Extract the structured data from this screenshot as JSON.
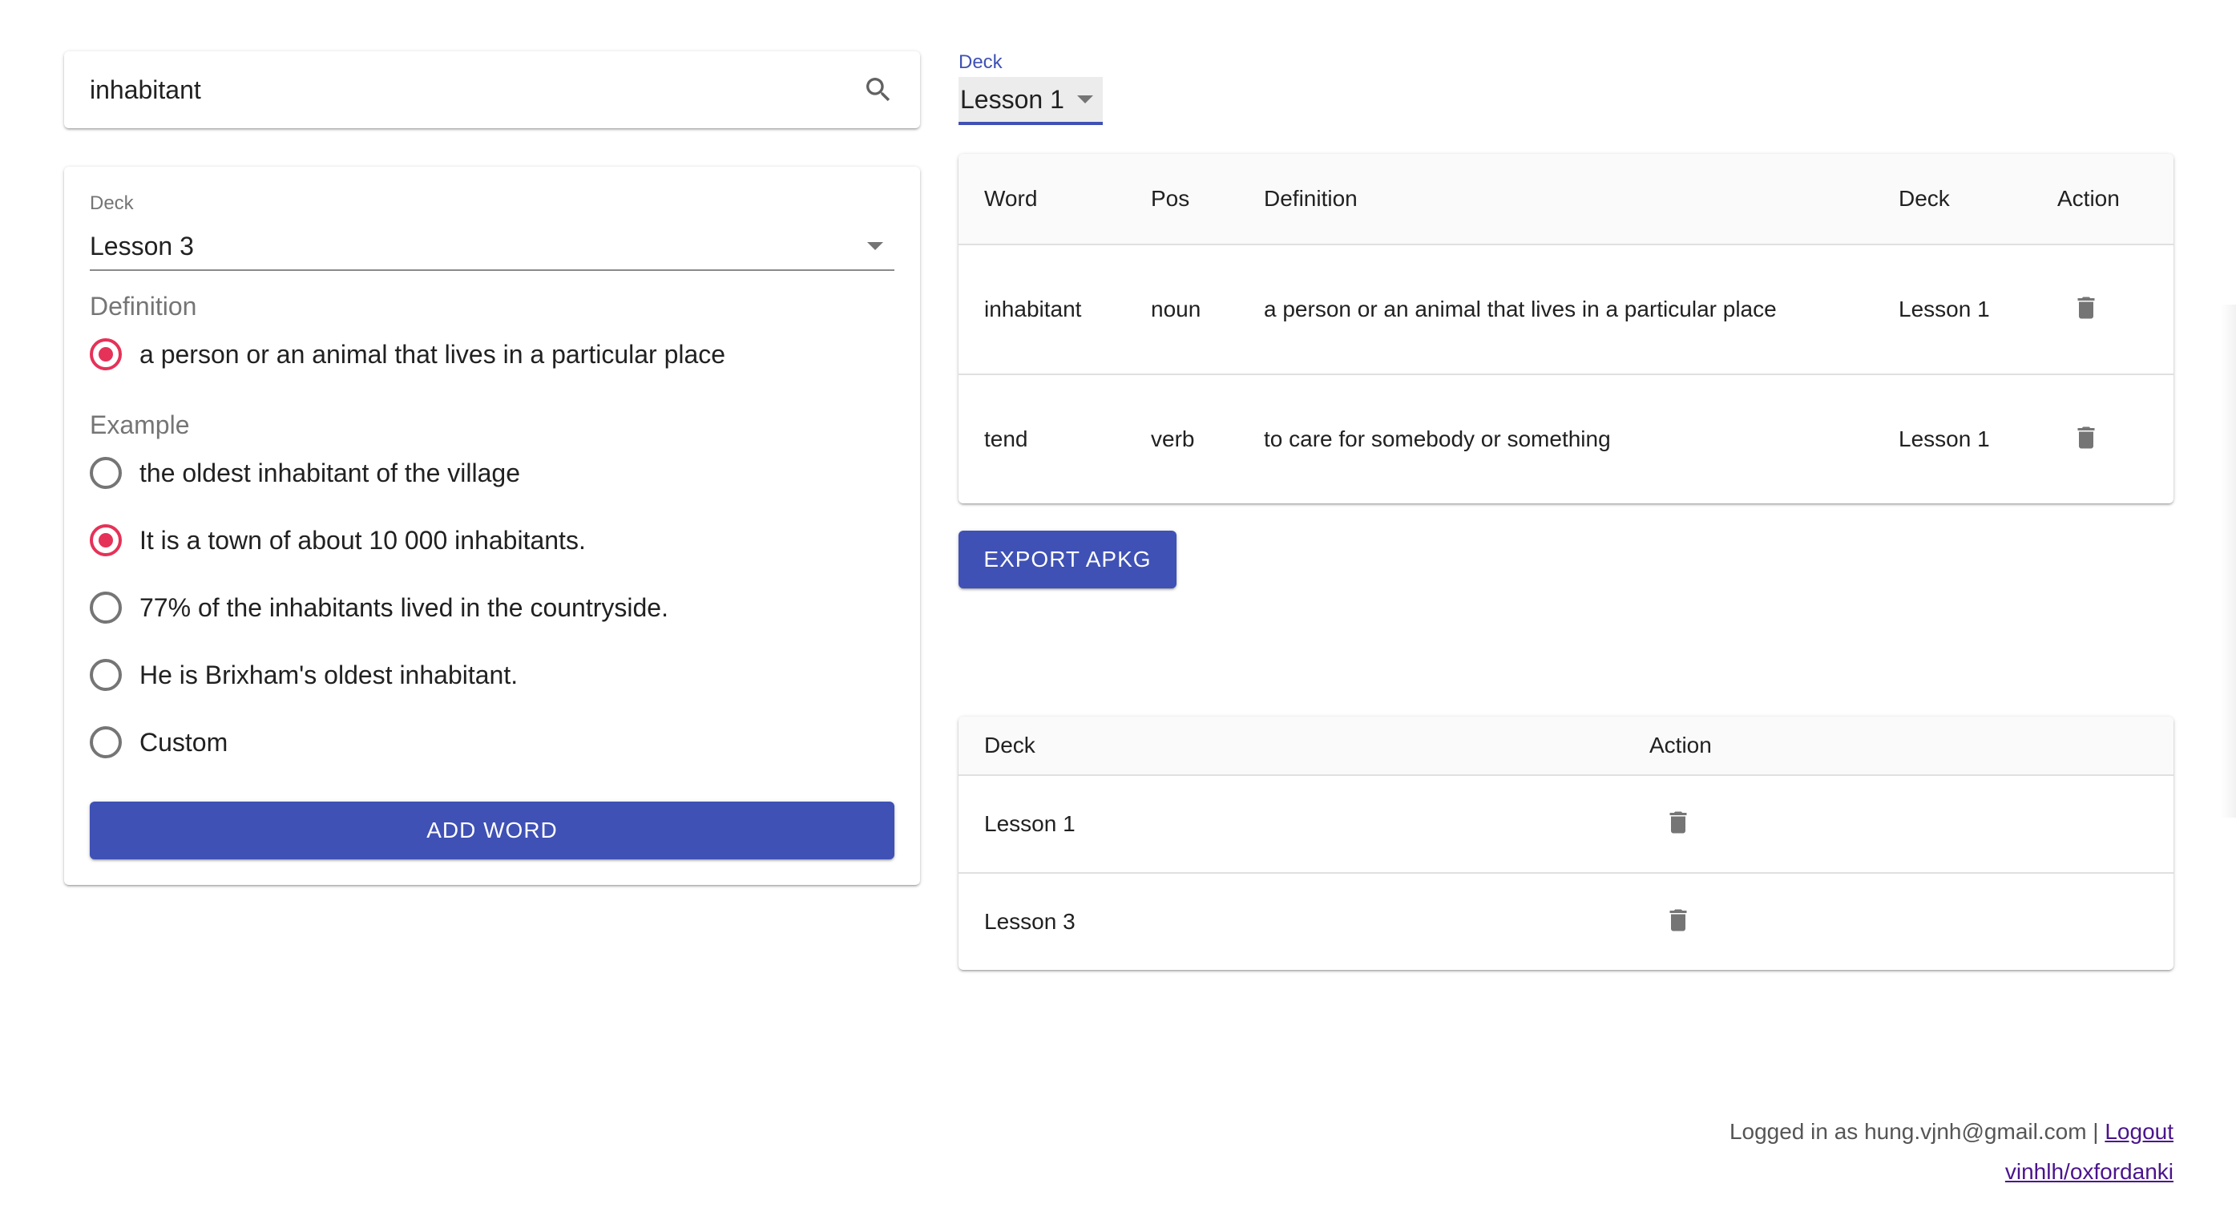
{
  "search": {
    "value": "inhabitant",
    "placeholder": ""
  },
  "word_form": {
    "deck_label": "Deck",
    "deck_value": "Lesson 3",
    "definition_label": "Definition",
    "definitions": [
      {
        "text": "a person or an animal that lives in a particular place",
        "checked": true
      }
    ],
    "example_label": "Example",
    "examples": [
      {
        "text": "the oldest inhabitant of the village",
        "checked": false
      },
      {
        "text": "It is a town of about 10 000 inhabitants.",
        "checked": true
      },
      {
        "text": "77% of the inhabitants lived in the countryside.",
        "checked": false
      },
      {
        "text": "He is Brixham's oldest inhabitant.",
        "checked": false
      },
      {
        "text": "Custom",
        "checked": false
      }
    ],
    "add_button_label": "ADD WORD"
  },
  "deck_filter": {
    "label": "Deck",
    "value": "Lesson 1"
  },
  "words_table": {
    "headers": [
      "Word",
      "Pos",
      "Definition",
      "Deck",
      "Action"
    ],
    "rows": [
      {
        "word": "inhabitant",
        "pos": "noun",
        "definition": "a person or an animal that lives in a particular place",
        "deck": "Lesson 1",
        "action_icon": "trash-icon"
      },
      {
        "word": "tend",
        "pos": "verb",
        "definition": "to care for somebody or something",
        "deck": "Lesson 1",
        "action_icon": "trash-icon"
      }
    ]
  },
  "export_button_label": "EXPORT APKG",
  "decks_table": {
    "headers": [
      "Deck",
      "Action"
    ],
    "rows": [
      {
        "deck": "Lesson 1",
        "action_icon": "trash-icon"
      },
      {
        "deck": "Lesson 3",
        "action_icon": "trash-icon"
      }
    ]
  },
  "footer": {
    "logged_in_text": "Logged in as hung.vjnh@gmail.com |",
    "logout_label": "Logout",
    "repo_link": "vinhlh/oxfordanki"
  },
  "colors": {
    "primary": "#3f51b5",
    "radio_checked": "#e53258",
    "link": "#4a148c"
  }
}
